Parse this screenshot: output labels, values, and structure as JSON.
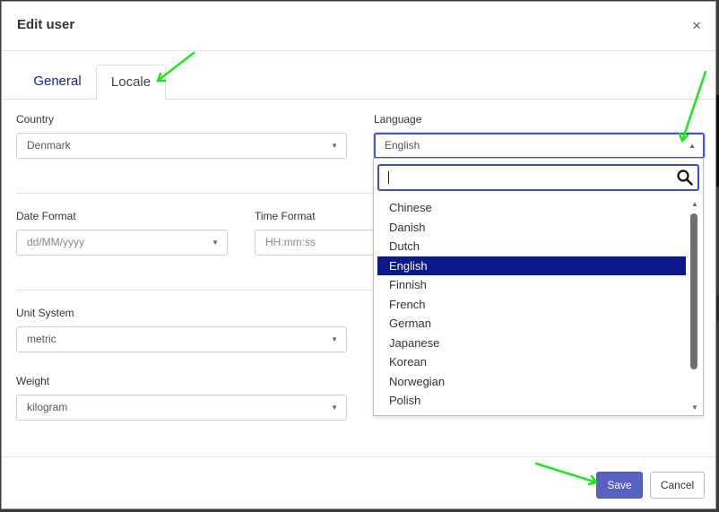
{
  "dialog": {
    "title": "Edit user",
    "close_symbol": "×"
  },
  "tabs": [
    {
      "label": "General",
      "active": false
    },
    {
      "label": "Locale",
      "active": true
    }
  ],
  "fields": {
    "country": {
      "label": "Country",
      "value": "Denmark"
    },
    "language": {
      "label": "Language",
      "value": "English"
    },
    "date_format": {
      "label": "Date Format",
      "placeholder": "dd/MM/yyyy"
    },
    "time_format": {
      "label": "Time Format",
      "placeholder": "HH:mm:ss"
    },
    "unit_system": {
      "label": "Unit System",
      "value": "metric"
    },
    "weight": {
      "label": "Weight",
      "value": "kilogram"
    }
  },
  "language_dropdown": {
    "search_value": "",
    "options": [
      "Chinese",
      "Danish",
      "Dutch",
      "English",
      "Finnish",
      "French",
      "German",
      "Japanese",
      "Korean",
      "Norwegian",
      "Polish"
    ],
    "selected": "English"
  },
  "footer": {
    "save_label": "Save",
    "cancel_label": "Cancel"
  },
  "icons": {
    "dropdown_caret": "caret-down-icon",
    "dropdown_caret_open": "caret-up-icon",
    "search": "search-icon",
    "close": "close-icon"
  },
  "colors": {
    "primary": "#5862c0",
    "selected_option": "#0a1a8c",
    "focus_border": "#3d4cbf",
    "tab_link": "#17238c",
    "annotation_arrow": "#1ee61e"
  }
}
